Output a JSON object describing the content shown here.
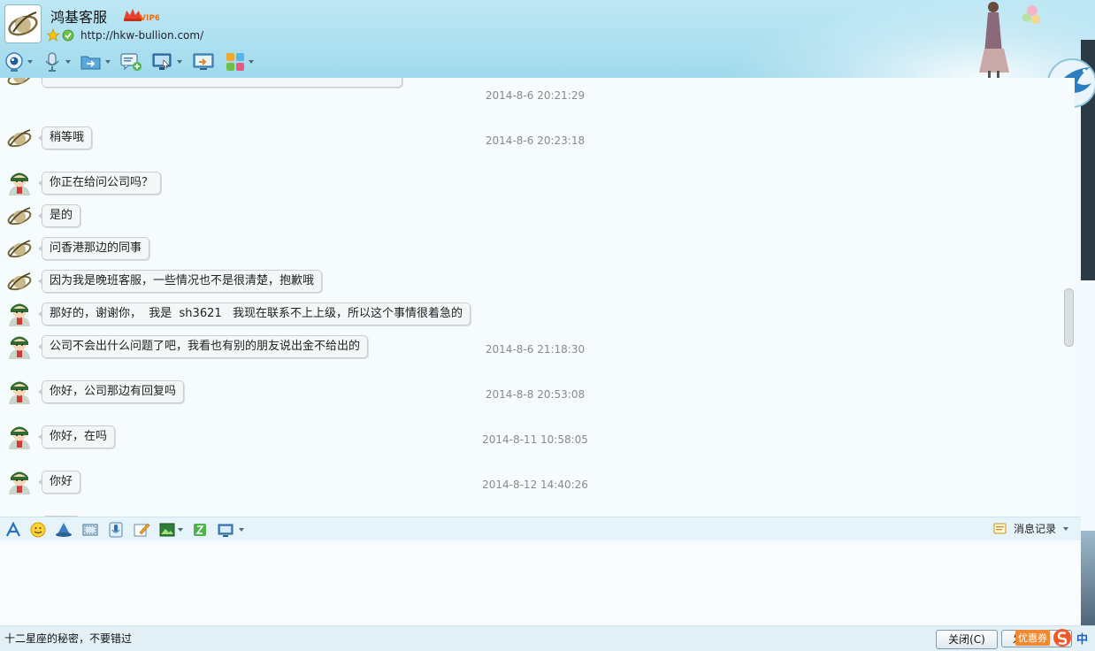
{
  "header": {
    "contact_name": "鸿基客服",
    "vip_label": "VIP6",
    "url": "http://hkw-bullion.com/",
    "toolbar": [
      {
        "name": "video-call-button",
        "icon": "webcam-icon"
      },
      {
        "name": "voice-call-button",
        "icon": "microphone-icon"
      },
      {
        "name": "send-file-button",
        "icon": "folder-icon"
      },
      {
        "name": "create-discussion-button",
        "icon": "chat-add-icon"
      },
      {
        "name": "remote-assist-button",
        "icon": "monitor-icon"
      },
      {
        "name": "share-screen-button",
        "icon": "screen-share-icon"
      },
      {
        "name": "apps-button",
        "icon": "apps-grid-icon"
      }
    ]
  },
  "messages": [
    {
      "type": "timestamp",
      "text": "2014-8-6 20:21:29"
    },
    {
      "type": "msg",
      "sender": "service",
      "text": "稍等哦"
    },
    {
      "type": "timestamp",
      "text": "2014-8-6 20:23:18"
    },
    {
      "type": "msg",
      "sender": "user",
      "text": "你正在给问公司吗？"
    },
    {
      "type": "msg",
      "sender": "service",
      "text": "是的"
    },
    {
      "type": "msg",
      "sender": "service",
      "text": "问香港那边的同事"
    },
    {
      "type": "msg",
      "sender": "service",
      "text": "因为我是晚班客服，一些情况也不是很清楚，抱歉哦"
    },
    {
      "type": "msg",
      "sender": "user",
      "text": "那好的，谢谢你，  我是  sh3621   我现在联系不上上级，所以这个事情很着急的"
    },
    {
      "type": "msg",
      "sender": "user",
      "text": "公司不会出什么问题了吧，我看也有别的朋友说出金不给出的"
    },
    {
      "type": "timestamp",
      "text": "2014-8-6 21:18:30"
    },
    {
      "type": "msg",
      "sender": "user",
      "text": "你好，公司那边有回复吗"
    },
    {
      "type": "timestamp",
      "text": "2014-8-8 20:53:08"
    },
    {
      "type": "msg",
      "sender": "user",
      "text": "你好，在吗"
    },
    {
      "type": "timestamp",
      "text": "2014-8-11 10:58:05"
    },
    {
      "type": "msg",
      "sender": "user",
      "text": "你好"
    },
    {
      "type": "timestamp",
      "text": "2014-8-12 14:40:26"
    },
    {
      "type": "msg",
      "sender": "user",
      "text": "你好"
    }
  ],
  "input_toolbar": {
    "icons": [
      "font-icon",
      "emoji-icon",
      "magic-expression-icon",
      "screenshot-icon",
      "voice-message-icon",
      "handwriting-icon",
      "image-icon",
      "shake-icon",
      "more-tools-icon"
    ],
    "history_label": "消息记录"
  },
  "bottom": {
    "ad_text": "十二星座的秘密，不要错过",
    "close_label": "关闭(C)",
    "send_label": "发送(S)",
    "ime_promo": "优惠券",
    "ime_mode": "中"
  },
  "colors": {
    "header_bg": "#a8dcee",
    "chat_bg": "#f6fbfd",
    "bubble_bg": "#f4f6f8",
    "timestamp": "#8a8a8a"
  }
}
